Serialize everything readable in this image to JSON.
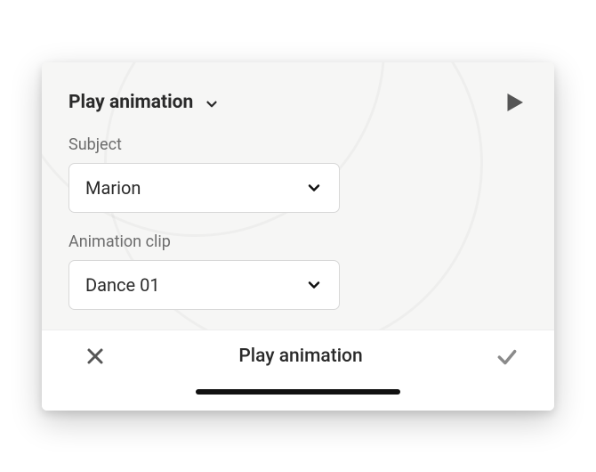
{
  "header": {
    "title": "Play animation"
  },
  "fields": {
    "subject": {
      "label": "Subject",
      "value": "Marion"
    },
    "animation_clip": {
      "label": "Animation clip",
      "value": "Dance 01"
    }
  },
  "footer": {
    "title": "Play animation"
  }
}
